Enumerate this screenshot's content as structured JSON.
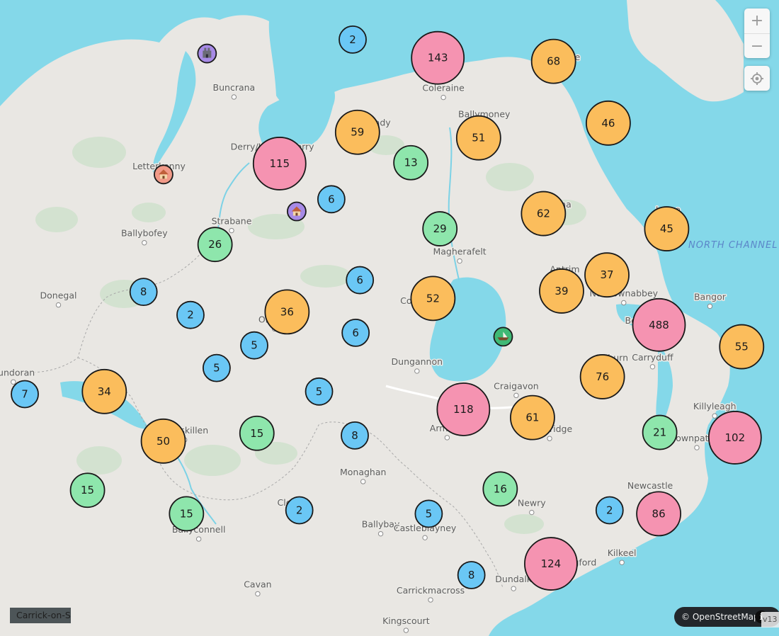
{
  "colors": {
    "sea": "#84d8e9",
    "land": "#e9e7e3",
    "forest": "#cfe0cd",
    "river": "#7cd2e6",
    "large_cluster": "#f593b1",
    "medium_cluster": "#fbbd5c",
    "small_green_cluster": "#8ee6ac",
    "small_blue_cluster": "#6ac7f5",
    "marker_purple": "#a78ae6",
    "marker_pink": "#f19a88",
    "marker_green": "#3fb975"
  },
  "sea_label": "NORTH CHANNEL",
  "towns": [
    {
      "name": "Buncrana",
      "lon": -7.453,
      "lat": 55.133
    },
    {
      "name": "Ballycastle",
      "lon": -6.245,
      "lat": 55.203
    },
    {
      "name": "Coleraine",
      "lon": -6.668,
      "lat": 55.132
    },
    {
      "name": "Ballymoney",
      "lon": -6.515,
      "lat": 55.072
    },
    {
      "name": "Limavady",
      "lon": -6.946,
      "lat": 55.052
    },
    {
      "name": "Derry/Londonderry",
      "lon": -7.309,
      "lat": 54.997
    },
    {
      "name": "Letterkenny",
      "lon": -7.734,
      "lat": 54.952
    },
    {
      "name": "Strabane",
      "lon": -7.462,
      "lat": 54.826
    },
    {
      "name": "Ballybofey",
      "lon": -7.789,
      "lat": 54.798
    },
    {
      "name": "Ballymena",
      "lon": -6.276,
      "lat": 54.864
    },
    {
      "name": "Larne",
      "lon": -5.826,
      "lat": 54.852
    },
    {
      "name": "Magherafelt",
      "lon": -6.607,
      "lat": 54.756
    },
    {
      "name": "Antrim",
      "lon": -6.213,
      "lat": 54.715
    },
    {
      "name": "Newtownabbey",
      "lon": -5.992,
      "lat": 54.66
    },
    {
      "name": "Bangor",
      "lon": -5.669,
      "lat": 54.652
    },
    {
      "name": "Cookstown",
      "lon": -6.739,
      "lat": 54.643
    },
    {
      "name": "Donegal",
      "lon": -8.111,
      "lat": 54.655
    },
    {
      "name": "Omagh",
      "lon": -7.301,
      "lat": 54.6
    },
    {
      "name": "Belfast",
      "lon": -5.93,
      "lat": 54.597
    },
    {
      "name": "Dungannon",
      "lon": -6.767,
      "lat": 54.503
    },
    {
      "name": "Lisburn",
      "lon": -6.036,
      "lat": 54.512
    },
    {
      "name": "Carryduff",
      "lon": -5.884,
      "lat": 54.513
    },
    {
      "name": "Bundoran",
      "lon": -8.28,
      "lat": 54.478
    },
    {
      "name": "Craigavon",
      "lon": -6.395,
      "lat": 54.447
    },
    {
      "name": "Killyleagh",
      "lon": -5.651,
      "lat": 54.4
    },
    {
      "name": "Enniskillen",
      "lon": -7.638,
      "lat": 54.345
    },
    {
      "name": "Armagh",
      "lon": -6.654,
      "lat": 54.35
    },
    {
      "name": "Banbridge",
      "lon": -6.27,
      "lat": 54.348
    },
    {
      "name": "Downpatrick",
      "lon": -5.718,
      "lat": 54.327
    },
    {
      "name": "Monaghan",
      "lon": -6.969,
      "lat": 54.249
    },
    {
      "name": "Newcastle",
      "lon": -5.893,
      "lat": 54.218
    },
    {
      "name": "Clones",
      "lon": -7.235,
      "lat": 54.179
    },
    {
      "name": "Newry",
      "lon": -6.337,
      "lat": 54.178
    },
    {
      "name": "Ballyconnell",
      "lon": -7.585,
      "lat": 54.117
    },
    {
      "name": "Ballybay",
      "lon": -6.903,
      "lat": 54.129
    },
    {
      "name": "Castleblayney",
      "lon": -6.737,
      "lat": 54.12
    },
    {
      "name": "Kilkeel",
      "lon": -5.999,
      "lat": 54.063
    },
    {
      "name": "Carlingford",
      "lon": -6.186,
      "lat": 54.041
    },
    {
      "name": "Dundalk",
      "lon": -6.405,
      "lat": 54.003
    },
    {
      "name": "Cavan",
      "lon": -7.364,
      "lat": 53.991
    },
    {
      "name": "Carrickmacross",
      "lon": -6.716,
      "lat": 53.977
    },
    {
      "name": "Kingscourt",
      "lon": -6.808,
      "lat": 53.907
    },
    {
      "name": "Carrick-on-Shannon",
      "lon": -8.09,
      "lat": 53.947
    }
  ],
  "clusters": [
    {
      "count": "2",
      "color": "#6ac7f5",
      "lon": -7.008,
      "lat": 55.265
    },
    {
      "count": "143",
      "color": "#f593b1",
      "lon": -6.689,
      "lat": 55.223
    },
    {
      "count": "68",
      "color": "#fbbd5c",
      "lon": -6.255,
      "lat": 55.215
    },
    {
      "count": "46",
      "color": "#fbbd5c",
      "lon": -6.05,
      "lat": 55.073
    },
    {
      "count": "59",
      "color": "#fbbd5c",
      "lon": -6.99,
      "lat": 55.052
    },
    {
      "count": "51",
      "color": "#fbbd5c",
      "lon": -6.536,
      "lat": 55.039
    },
    {
      "count": "115",
      "color": "#f593b1",
      "lon": -7.282,
      "lat": 54.98
    },
    {
      "count": "13",
      "color": "#8ee6ac",
      "lon": -6.79,
      "lat": 54.982
    },
    {
      "count": "6",
      "color": "#6ac7f5",
      "lon": -7.088,
      "lat": 54.898
    },
    {
      "count": "62",
      "color": "#fbbd5c",
      "lon": -6.293,
      "lat": 54.865
    },
    {
      "count": "45",
      "color": "#fbbd5c",
      "lon": -5.831,
      "lat": 54.83
    },
    {
      "count": "29",
      "color": "#8ee6ac",
      "lon": -6.681,
      "lat": 54.83
    },
    {
      "count": "26",
      "color": "#8ee6ac",
      "lon": -7.524,
      "lat": 54.794
    },
    {
      "count": "37",
      "color": "#fbbd5c",
      "lon": -6.055,
      "lat": 54.724
    },
    {
      "count": "6",
      "color": "#6ac7f5",
      "lon": -6.981,
      "lat": 54.712
    },
    {
      "count": "39",
      "color": "#fbbd5c",
      "lon": -6.225,
      "lat": 54.687
    },
    {
      "count": "8",
      "color": "#6ac7f5",
      "lon": -7.792,
      "lat": 54.685
    },
    {
      "count": "52",
      "color": "#fbbd5c",
      "lon": -6.707,
      "lat": 54.67
    },
    {
      "count": "36",
      "color": "#fbbd5c",
      "lon": -7.254,
      "lat": 54.639
    },
    {
      "count": "2",
      "color": "#6ac7f5",
      "lon": -7.616,
      "lat": 54.632
    },
    {
      "count": "488",
      "color": "#f593b1",
      "lon": -5.86,
      "lat": 54.609
    },
    {
      "count": "6",
      "color": "#6ac7f5",
      "lon": -6.997,
      "lat": 54.591
    },
    {
      "count": "55",
      "color": "#fbbd5c",
      "lon": -5.55,
      "lat": 54.559
    },
    {
      "count": "5",
      "color": "#6ac7f5",
      "lon": -7.377,
      "lat": 54.562
    },
    {
      "count": "5",
      "color": "#6ac7f5",
      "lon": -7.518,
      "lat": 54.51
    },
    {
      "count": "76",
      "color": "#fbbd5c",
      "lon": -6.072,
      "lat": 54.49
    },
    {
      "count": "7",
      "color": "#6ac7f5",
      "lon": -8.237,
      "lat": 54.45
    },
    {
      "count": "34",
      "color": "#fbbd5c",
      "lon": -7.939,
      "lat": 54.456
    },
    {
      "count": "5",
      "color": "#6ac7f5",
      "lon": -7.134,
      "lat": 54.456
    },
    {
      "count": "118",
      "color": "#f593b1",
      "lon": -6.593,
      "lat": 54.415
    },
    {
      "count": "61",
      "color": "#fbbd5c",
      "lon": -6.334,
      "lat": 54.396
    },
    {
      "count": "50",
      "color": "#fbbd5c",
      "lon": -7.718,
      "lat": 54.342
    },
    {
      "count": "15",
      "color": "#8ee6ac",
      "lon": -7.367,
      "lat": 54.36
    },
    {
      "count": "8",
      "color": "#6ac7f5",
      "lon": -7.0,
      "lat": 54.355
    },
    {
      "count": "21",
      "color": "#8ee6ac",
      "lon": -5.857,
      "lat": 54.362
    },
    {
      "count": "102",
      "color": "#f593b1",
      "lon": -5.575,
      "lat": 54.35
    },
    {
      "count": "15",
      "color": "#8ee6ac",
      "lon": -8.002,
      "lat": 54.229
    },
    {
      "count": "16",
      "color": "#8ee6ac",
      "lon": -6.455,
      "lat": 54.232
    },
    {
      "count": "2",
      "color": "#6ac7f5",
      "lon": -7.208,
      "lat": 54.183
    },
    {
      "count": "5",
      "color": "#6ac7f5",
      "lon": -6.723,
      "lat": 54.175
    },
    {
      "count": "2",
      "color": "#6ac7f5",
      "lon": -6.045,
      "lat": 54.183
    },
    {
      "count": "86",
      "color": "#f593b1",
      "lon": -5.861,
      "lat": 54.175
    },
    {
      "count": "15",
      "color": "#8ee6ac",
      "lon": -7.631,
      "lat": 54.175
    },
    {
      "count": "124",
      "color": "#f593b1",
      "lon": -6.265,
      "lat": 54.06
    },
    {
      "count": "8",
      "color": "#6ac7f5",
      "lon": -6.563,
      "lat": 54.034
    }
  ],
  "markers": [
    {
      "kind": "purple",
      "icon": "castle-icon",
      "lon": -7.554,
      "lat": 55.233
    },
    {
      "kind": "pink",
      "icon": "house-icon",
      "lon": -7.717,
      "lat": 54.955
    },
    {
      "kind": "purple",
      "icon": "house-icon",
      "lon": -7.218,
      "lat": 54.87
    },
    {
      "kind": "green",
      "icon": "boat-icon",
      "lon": -6.444,
      "lat": 54.582
    }
  ],
  "controls": {
    "zoom_in": "+",
    "zoom_out": "−",
    "locate_icon": "crosshair-icon"
  },
  "attribution": "© OpenStreetMap",
  "version": "v13",
  "bottom_left_town": "Carrick-on-Shannon"
}
